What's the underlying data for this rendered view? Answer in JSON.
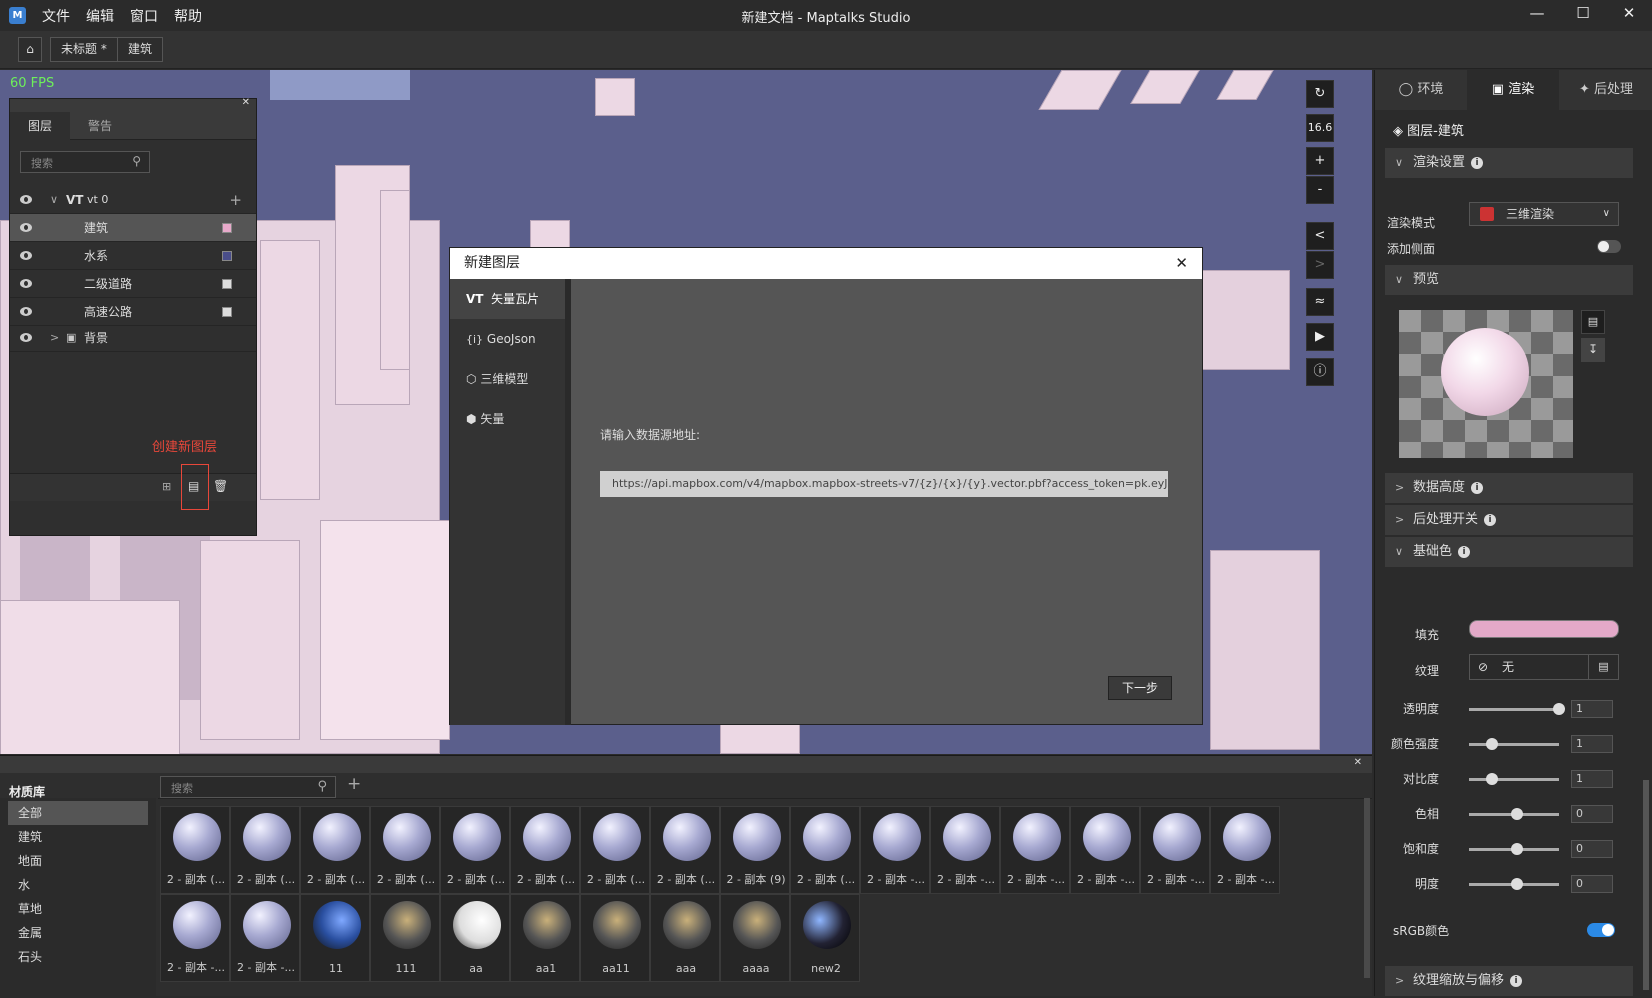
{
  "window": {
    "title": "新建文档 - Maptalks Studio",
    "menu": [
      "文件",
      "编辑",
      "窗口",
      "帮助"
    ]
  },
  "toolbar": {
    "breadcrumb": [
      "未标题 *",
      "建筑"
    ]
  },
  "viewport": {
    "fps": "60 FPS",
    "zoom": "16.6",
    "buttons": [
      "+",
      "-",
      "<",
      ">"
    ]
  },
  "layer_panel": {
    "tabs": [
      "图层",
      "警告"
    ],
    "search_placeholder": "搜索",
    "root": {
      "prefix": "VT",
      "name": "vt 0"
    },
    "layers": [
      {
        "name": "建筑",
        "color": "#e8aacb",
        "selected": true
      },
      {
        "name": "水系",
        "color": "#4a4e8a",
        "selected": false
      },
      {
        "name": "二级道路",
        "color": "#dddddd",
        "selected": false
      },
      {
        "name": "高速公路",
        "color": "#dddddd",
        "selected": false
      }
    ],
    "background": "背景",
    "annotation": "创建新图层"
  },
  "dialog": {
    "title": "新建图层",
    "sources": [
      {
        "icon": "VT",
        "label": "矢量瓦片"
      },
      {
        "icon": "{i}",
        "label": "GeoJson"
      },
      {
        "icon": "cube",
        "label": "三维模型"
      },
      {
        "icon": "hex",
        "label": "矢量"
      }
    ],
    "url_label": "请输入数据源地址:",
    "url_value": "https://api.mapbox.com/v4/mapbox.mapbox-streets-v7/{z}/{x}/{y}.vector.pbf?access_token=pk.eyJ1Ijoie",
    "next_button": "下一步"
  },
  "right_panel": {
    "tabs": [
      "环境",
      "渲染",
      "后处理"
    ],
    "layer_title": "图层-建筑",
    "render_settings": {
      "title": "渲染设置",
      "mode_label": "渲染模式",
      "mode_value": "三维渲染",
      "side_label": "添加侧面",
      "side_on": false
    },
    "preview_title": "预览",
    "data_height": "数据高度",
    "postprocess_switch": "后处理开关",
    "base_color": {
      "title": "基础色",
      "fill_label": "填充",
      "fill_color": "#e3a9c8",
      "texture_label": "纹理",
      "texture_value": "无",
      "params": [
        {
          "label": "透明度",
          "value": "1",
          "level": 1.0
        },
        {
          "label": "颜色强度",
          "value": "1",
          "level": 0.2
        },
        {
          "label": "对比度",
          "value": "1",
          "level": 0.2
        },
        {
          "label": "色相",
          "value": "0",
          "level": 0.5
        },
        {
          "label": "饱和度",
          "value": "0",
          "level": 0.5
        },
        {
          "label": "明度",
          "value": "0",
          "level": 0.5
        }
      ],
      "srgb_label": "sRGB颜色",
      "srgb_on": true
    },
    "texture_scale": "纹理缩放与偏移"
  },
  "material_library": {
    "title": "材质库",
    "search_placeholder": "搜索",
    "categories": [
      "全部",
      "建筑",
      "地面",
      "水",
      "草地",
      "金属",
      "石头"
    ],
    "selected_category": "全部",
    "materials": [
      "2 - 副本 (...",
      "2 - 副本 (...",
      "2 - 副本 (...",
      "2 - 副本 (...",
      "2 - 副本 (...",
      "2 - 副本 (...",
      "2 - 副本 (...",
      "2 - 副本 (...",
      "2 - 副本 (9)",
      "2 - 副本 (...",
      "2 - 副本 -...",
      "2 - 副本 -...",
      "2 - 副本 -...",
      "2 - 副本 -...",
      "2 - 副本 -...",
      "2 - 副本 -...",
      "2 - 副本 -...",
      "2 - 副本 -...",
      "11",
      "111",
      "aa",
      "aa1",
      "aa11",
      "aaa",
      "aaaa",
      "new2"
    ]
  }
}
